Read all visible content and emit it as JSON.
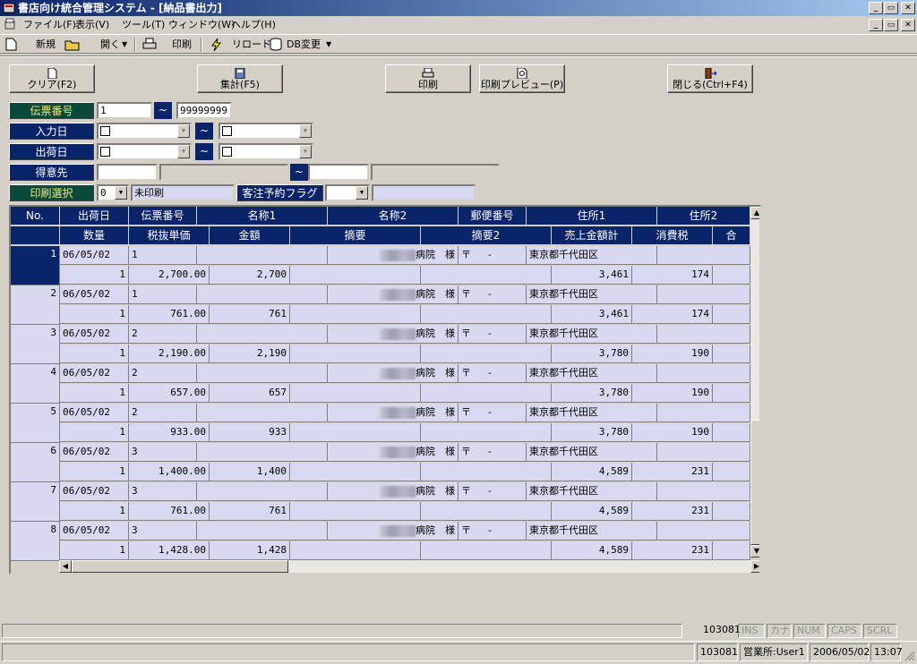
{
  "window": {
    "title": "書店向け統合管理システム - [納品書出力]",
    "min": "_",
    "max": "▭",
    "close": "✕"
  },
  "menu": [
    "ファイル(F)",
    "表示(V)",
    "ツール(T)",
    "ウィンドウ(W)",
    "ヘルプ(H)"
  ],
  "toolbar": {
    "new": "新規",
    "open": "開く",
    "print": "印刷",
    "reload": "リロード",
    "db": "DB変更"
  },
  "buttons": {
    "clear": "クリア(F2)",
    "sum": "集計(F5)",
    "print": "印刷",
    "preview": "印刷プレビュー(P)",
    "close": "閉じる(Ctrl+F4)"
  },
  "form": {
    "slip_label": "伝票番号",
    "slip_from": "1",
    "slip_to": "99999999",
    "tilde": "~",
    "input_date_label": "入力日",
    "ship_date_label": "出荷日",
    "customer_label": "得意先",
    "print_sel_label": "印刷選択",
    "print_sel_code": "0",
    "print_sel_text": "未印刷",
    "order_flag_label": "客注予約フラグ"
  },
  "grid": {
    "header1": [
      "No.",
      "出荷日",
      "伝票番号",
      "名称1",
      "名称2",
      "郵便番号",
      "住所1",
      "住所2"
    ],
    "header2": [
      "数量",
      "税抜単価",
      "金額",
      "摘要",
      "摘要2",
      "売上金額計",
      "消費税",
      "合"
    ],
    "rows": [
      {
        "no": "1",
        "date": "06/05/02",
        "slip": "1",
        "name2": "病院　様",
        "zip": "〒　 -",
        "addr": "東京都千代田区",
        "qty": "1",
        "price": "2,700.00",
        "amount": "2,700",
        "total": "3,461",
        "tax": "174"
      },
      {
        "no": "2",
        "date": "06/05/02",
        "slip": "1",
        "name2": "病院　様",
        "zip": "〒　 -",
        "addr": "東京都千代田区",
        "qty": "1",
        "price": "761.00",
        "amount": "761",
        "total": "3,461",
        "tax": "174"
      },
      {
        "no": "3",
        "date": "06/05/02",
        "slip": "2",
        "name2": "病院　様",
        "zip": "〒　 -",
        "addr": "東京都千代田区",
        "qty": "1",
        "price": "2,190.00",
        "amount": "2,190",
        "total": "3,780",
        "tax": "190"
      },
      {
        "no": "4",
        "date": "06/05/02",
        "slip": "2",
        "name2": "病院　様",
        "zip": "〒　 -",
        "addr": "東京都千代田区",
        "qty": "1",
        "price": "657.00",
        "amount": "657",
        "total": "3,780",
        "tax": "190"
      },
      {
        "no": "5",
        "date": "06/05/02",
        "slip": "2",
        "name2": "病院　様",
        "zip": "〒　 -",
        "addr": "東京都千代田区",
        "qty": "1",
        "price": "933.00",
        "amount": "933",
        "total": "3,780",
        "tax": "190"
      },
      {
        "no": "6",
        "date": "06/05/02",
        "slip": "3",
        "name2": "病院　様",
        "zip": "〒　 -",
        "addr": "東京都千代田区",
        "qty": "1",
        "price": "1,400.00",
        "amount": "1,400",
        "total": "4,589",
        "tax": "231"
      },
      {
        "no": "7",
        "date": "06/05/02",
        "slip": "3",
        "name2": "病院　様",
        "zip": "〒　 -",
        "addr": "東京都千代田区",
        "qty": "1",
        "price": "761.00",
        "amount": "761",
        "total": "4,589",
        "tax": "231"
      },
      {
        "no": "8",
        "date": "06/05/02",
        "slip": "3",
        "name2": "病院　様",
        "zip": "〒　 -",
        "addr": "東京都千代田区",
        "qty": "1",
        "price": "1,428.00",
        "amount": "1,428",
        "total": "4,589",
        "tax": "231"
      }
    ]
  },
  "status1": {
    "code": "103081",
    "ins": "INS",
    "kana": "カナ",
    "num": "NUM",
    "caps": "CAPS",
    "scrl": "SCRL"
  },
  "status2": {
    "code": "103081",
    "office": "営業所:User1",
    "date": "2006/05/02",
    "time": "13:07"
  }
}
